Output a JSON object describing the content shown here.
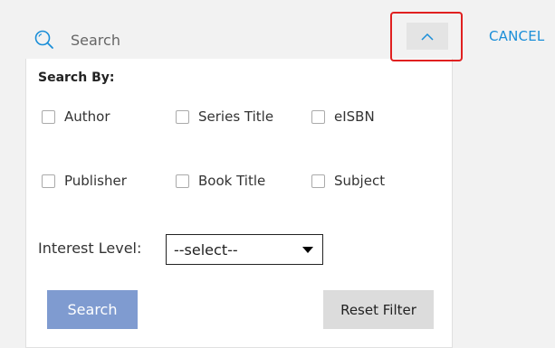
{
  "search": {
    "placeholder": "Search"
  },
  "header": {
    "cancel_label": "CANCEL"
  },
  "filter": {
    "heading": "Search By:",
    "options": [
      {
        "label": "Author"
      },
      {
        "label": "Series Title"
      },
      {
        "label": "eISBN"
      },
      {
        "label": "Publisher"
      },
      {
        "label": "Book Title"
      },
      {
        "label": "Subject"
      }
    ],
    "interest_label": "Interest Level:",
    "interest_value": "--select--",
    "search_label": "Search",
    "reset_label": "Reset Filter"
  },
  "colors": {
    "accent": "#1a8ed8",
    "search_button": "#7f9bd0",
    "highlight": "#e02020"
  }
}
